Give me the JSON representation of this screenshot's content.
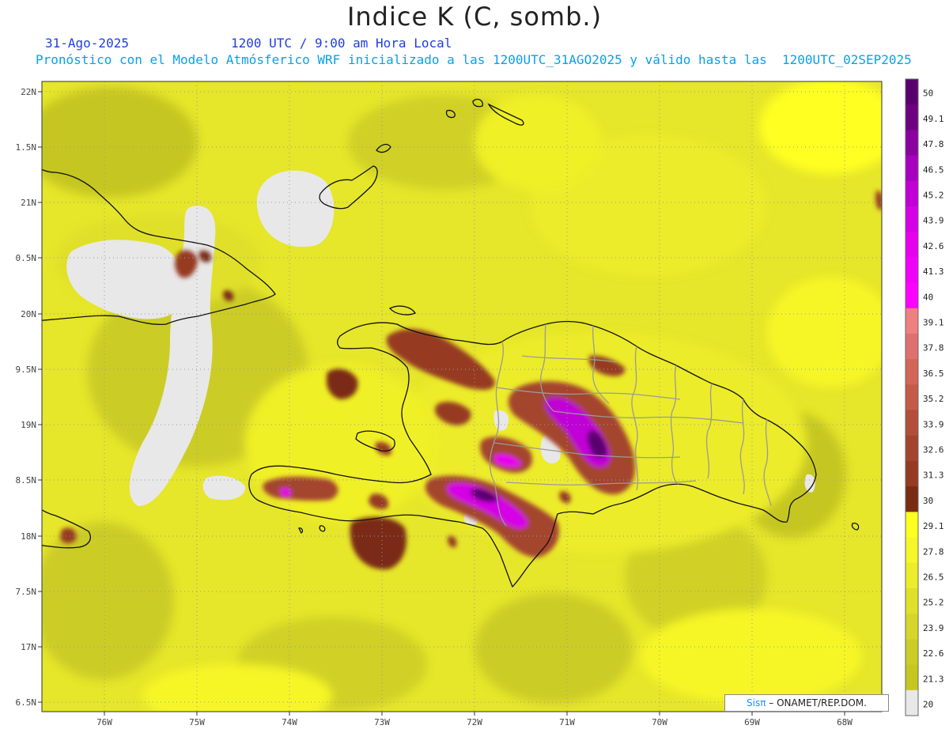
{
  "header": {
    "title": "Indice K (C, somb.)",
    "date": "31-Ago-2025",
    "time": "1200 UTC / 9:00 am Hora Local",
    "description": "Pronóstico con el Modelo Atmósferico WRF inicializado a las 1200UTC_31AGO2025 y válido hasta las  1200UTC_02SEP2025"
  },
  "axes": {
    "lat_labels": [
      "22N",
      "1.5N",
      "21N",
      "0.5N",
      "20N",
      "9.5N",
      "19N",
      "8.5N",
      "18N",
      "7.5N",
      "17N",
      "6.5N"
    ],
    "lon_labels": [
      "76W",
      "75W",
      "74W",
      "73W",
      "72W",
      "71W",
      "70W",
      "69W",
      "68W"
    ]
  },
  "colorbar": {
    "labels": [
      "50",
      "49.1",
      "47.8",
      "46.5",
      "45.2",
      "43.9",
      "42.6",
      "41.3",
      "40",
      "39.1",
      "37.8",
      "36.5",
      "35.2",
      "33.9",
      "32.6",
      "31.3",
      "30",
      "29.1",
      "27.8",
      "26.5",
      "25.2",
      "23.9",
      "22.6",
      "21.3",
      "20"
    ],
    "colors": [
      "#5a006e",
      "#6e0082",
      "#8c00a0",
      "#a800be",
      "#c000d6",
      "#d600e6",
      "#e800f0",
      "#f000f8",
      "#ff00ff",
      "#f08080",
      "#e07070",
      "#d26458",
      "#c45a48",
      "#b24e3a",
      "#a4442e",
      "#963a22",
      "#7a2c12",
      "#ffff20",
      "#f6f628",
      "#ecec2a",
      "#e0e02a",
      "#d6d62a",
      "#cccc26",
      "#c6c620",
      "#e8e8e8"
    ]
  },
  "credit": {
    "sis": "Sisπ",
    "rest": "– ONAMET/REP.DOM."
  }
}
